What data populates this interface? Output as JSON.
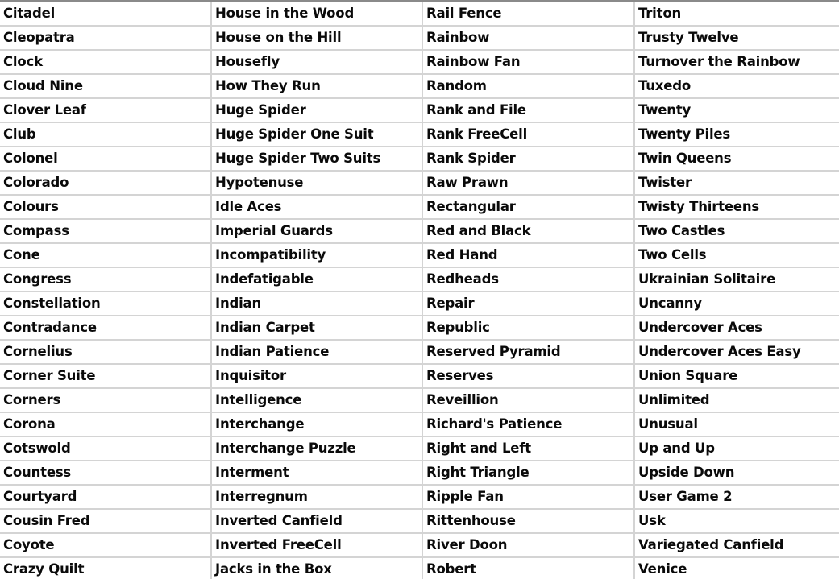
{
  "sheet": {
    "columns": [
      {
        "cells": [
          "Citadel",
          "Cleopatra",
          "Clock",
          "Cloud Nine",
          "Clover Leaf",
          "Club",
          "Colonel",
          "Colorado",
          "Colours",
          "Compass",
          "Cone",
          "Congress",
          "Constellation",
          "Contradance",
          "Cornelius",
          "Corner Suite",
          "Corners",
          "Corona",
          "Cotswold",
          "Countess",
          "Courtyard",
          "Cousin Fred",
          "Coyote",
          "Crazy Quilt"
        ]
      },
      {
        "cells": [
          "House in the Wood",
          "House on the Hill",
          "Housefly",
          "How They Run",
          "Huge Spider",
          "Huge Spider One Suit",
          "Huge Spider Two Suits",
          "Hypotenuse",
          "Idle Aces",
          "Imperial Guards",
          "Incompatibility",
          "Indefatigable",
          "Indian",
          "Indian Carpet",
          "Indian Patience",
          "Inquisitor",
          "Intelligence",
          "Interchange",
          "Interchange Puzzle",
          "Interment",
          "Interregnum",
          "Inverted Canfield",
          "Inverted FreeCell",
          "Jacks in the Box"
        ]
      },
      {
        "cells": [
          "Rail Fence",
          "Rainbow",
          "Rainbow Fan",
          "Random",
          "Rank and File",
          "Rank FreeCell",
          "Rank Spider",
          "Raw Prawn",
          "Rectangular",
          "Red and Black",
          "Red Hand",
          "Redheads",
          "Repair",
          "Republic",
          "Reserved Pyramid",
          "Reserves",
          "Reveillion",
          "Richard's Patience",
          "Right and Left",
          "Right Triangle",
          "Ripple Fan",
          "Rittenhouse",
          "River Doon",
          "Robert"
        ]
      },
      {
        "cells": [
          "Triton",
          "Trusty Twelve",
          "Turnover the Rainbow",
          "Tuxedo",
          "Twenty",
          "Twenty Piles",
          "Twin Queens",
          "Twister",
          "Twisty Thirteens",
          "Two Castles",
          "Two Cells",
          "Ukrainian Solitaire",
          "Uncanny",
          "Undercover Aces",
          "Undercover Aces Easy",
          "Union Square",
          "Unlimited",
          "Unusual",
          "Up and Up",
          "Upside Down",
          "User Game 2",
          "Usk",
          "Variegated Canfield",
          "Venice"
        ]
      }
    ]
  }
}
